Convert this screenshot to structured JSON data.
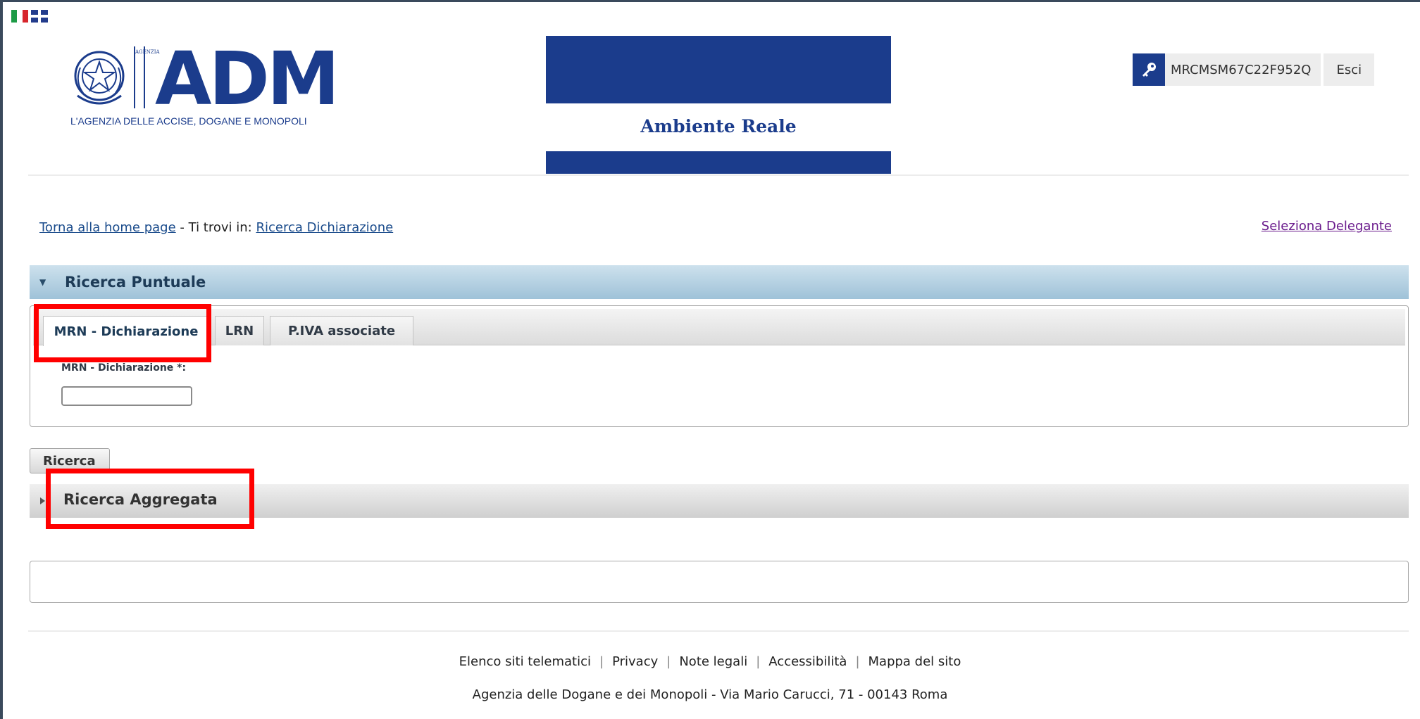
{
  "header": {
    "logo_text": "ADM",
    "logo_vertical_text": "AGENZIA",
    "logo_subtitle": "L'AGENZIA DELLE ACCISE, DOGANE E MONOPOLI",
    "environment_label": "Ambiente Reale",
    "user_code": "MRCMSM67C22F952Q",
    "logout_label": "Esci",
    "brand_color": "#1b3c8c"
  },
  "breadcrumb": {
    "home_link": "Torna alla home page",
    "separator": "- Ti trovi in:",
    "current_link": "Ricerca Dichiarazione",
    "delegante_link": "Seleziona Delegante"
  },
  "ricerca_puntuale": {
    "title": "Ricerca Puntuale",
    "tabs": [
      {
        "label": "MRN - Dichiarazione",
        "active": true
      },
      {
        "label": "LRN",
        "active": false
      },
      {
        "label": "P.IVA associate",
        "active": false
      }
    ],
    "field_label": "MRN - Dichiarazione *:",
    "field_value": ""
  },
  "search_button_label": "Ricerca",
  "ricerca_aggregata": {
    "title": "Ricerca Aggregata"
  },
  "footer": {
    "links": [
      "Elenco siti telematici",
      "Privacy",
      "Note legali",
      "Accessibilità",
      "Mappa del sito"
    ],
    "address": "Agenzia delle Dogane e dei Monopoli - Via Mario Carucci, 71 - 00143 Roma"
  },
  "colors": {
    "highlight": "#ff0000",
    "panel_header": "#9fc2d8",
    "delegante_link": "#6a1b8c"
  }
}
